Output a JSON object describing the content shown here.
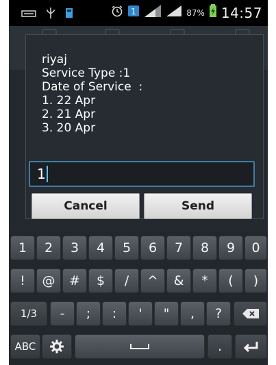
{
  "status_bar": {
    "battery_percent": "87%",
    "time": "14:57",
    "icons": [
      "voicemail-icon",
      "usb-icon",
      "sd-card-icon",
      "alarm-icon",
      "notification-badge-icon",
      "signal-icon",
      "signal-icon",
      "battery-charging-icon"
    ],
    "notification_badge": "1"
  },
  "dialog": {
    "message_lines": [
      "riyaj",
      "Service Type :1",
      "Date of Service  :",
      "1. 22 Apr",
      "2. 21 Apr",
      "3. 20 Apr"
    ],
    "input_value": "1",
    "cancel_label": "Cancel",
    "send_label": "Send"
  },
  "keyboard": {
    "row1": [
      "1",
      "2",
      "3",
      "4",
      "5",
      "6",
      "7",
      "8",
      "9",
      "0"
    ],
    "row2": [
      "!",
      "@",
      "#",
      "$",
      "/",
      "^",
      "&",
      "*",
      "(",
      ")"
    ],
    "row3": [
      "1/3",
      "-",
      ";",
      ":",
      "'",
      "\"",
      ",",
      "?"
    ],
    "row4": {
      "mode_label": "ABC",
      "period": "."
    }
  },
  "colors": {
    "accent": "#3d7fa3",
    "dialog_bg": "#262c31",
    "keyboard_bg": "#23272b"
  }
}
